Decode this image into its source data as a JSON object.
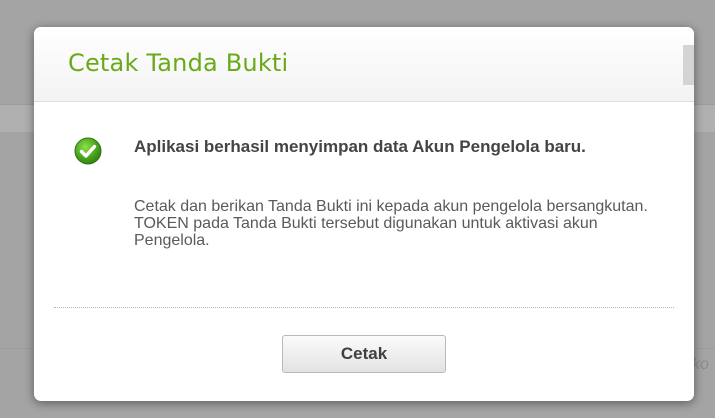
{
  "dialog": {
    "title": "Cetak Tanda Bukti",
    "message_title": "Aplikasi berhasil menyimpan data Akun Pengelola baru.",
    "message_body_line1": "Cetak dan berikan Tanda Bukti ini kepada akun pengelola bersangkutan.",
    "message_body_line2": "TOKEN pada Tanda Bukti tersebut digunakan untuk aktivasi akun Pengelola.",
    "status_icon": "check-circle-icon",
    "print_button_label": "Cetak"
  },
  "background": {
    "partial_text": "ko"
  },
  "colors": {
    "title": "#6aaa1a",
    "success": "#4aa51e",
    "overlay": "#a4a4a4"
  }
}
